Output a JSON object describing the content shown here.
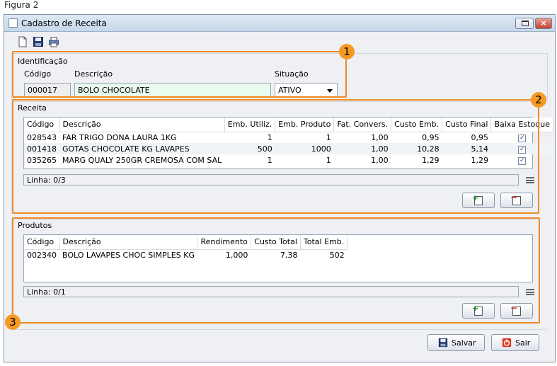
{
  "figure_label": "Figura 2",
  "window": {
    "title": "Cadastro de Receita",
    "close_glyph": "×"
  },
  "toolbar": {
    "icons": [
      "new-document-icon",
      "save-icon",
      "print-icon"
    ]
  },
  "identificacao": {
    "title": "Identificação",
    "codigo_label": "Código",
    "descricao_label": "Descrição",
    "situacao_label": "Situação",
    "codigo_value": "000017",
    "descricao_value": "BOLO CHOCOLATE",
    "situacao_value": "ATIVO"
  },
  "receita": {
    "title": "Receita",
    "columns": [
      "Código",
      "Descrição",
      "Emb. Utiliz.",
      "Emb. Produto",
      "Fat. Convers.",
      "Custo Emb.",
      "Custo Final",
      "Baixa Estoque"
    ],
    "rows": [
      [
        "028543",
        "FAR TRIGO DONA LAURA 1KG",
        "1",
        "1",
        "1,00",
        "0,95",
        "0,95",
        "✓"
      ],
      [
        "001418",
        "GOTAS CHOCOLATE KG LAVAPES",
        "500",
        "1000",
        "1,00",
        "10,28",
        "5,14",
        "✓"
      ],
      [
        "035265",
        "MARG QUALY 250GR CREMOSA COM SAL",
        "1",
        "1",
        "1,00",
        "1,29",
        "1,29",
        "✓"
      ]
    ],
    "status": "Linha: 0/3"
  },
  "produtos": {
    "title": "Produtos",
    "columns": [
      "Código",
      "Descrição",
      "Rendimento",
      "Custo Total",
      "Total Emb."
    ],
    "rows": [
      [
        "002340",
        "BOLO LAVAPES CHOC SIMPLES KG",
        "1,000",
        "7,38",
        "502"
      ]
    ],
    "status": "Linha: 0/1"
  },
  "buttons": {
    "salvar": "Salvar",
    "sair": "Sair"
  },
  "callouts": [
    "1",
    "2",
    "3"
  ],
  "colors": {
    "callout": "#f08a24",
    "badge": "#f59a23",
    "description_field": "#e8fbec"
  }
}
